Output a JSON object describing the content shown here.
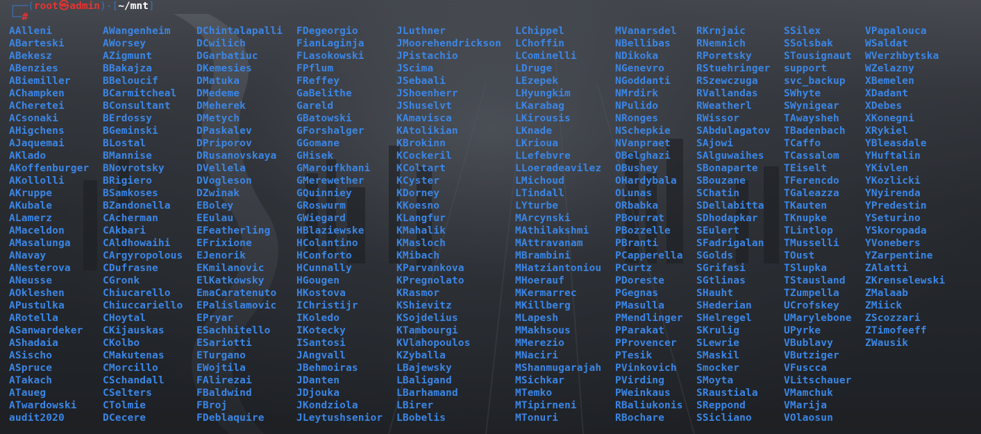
{
  "prompt": {
    "user": "root",
    "host": "admin",
    "cwd": "~/mnt",
    "symbol": "#"
  },
  "listing": {
    "columns": [
      [
        "AAlleni",
        "ABarteski",
        "ABekesz",
        "ABenzies",
        "ABiemiller",
        "AChampken",
        "ACheretei",
        "ACsonaki",
        "AHigchens",
        "AJaquemai",
        "AKlado",
        "AKoffenburger",
        "AKollolli",
        "AKruppe",
        "AKubale",
        "ALamerz",
        "AMaceldon",
        "AMasalunga",
        "ANavay",
        "ANesterova",
        "ANeusse",
        "AOkleshen",
        "APustulka",
        "ARotella",
        "ASanwardeker",
        "AShadaia",
        "ASischo",
        "ASpruce",
        "ATakach",
        "ATaueg",
        "ATwardowski",
        "audit2020"
      ],
      [
        "AWangenheim",
        "AWorsey",
        "AZigmunt",
        "BBakajza",
        "BBeloucif",
        "BCarmitcheal",
        "BConsultant",
        "BErdossy",
        "BGeminski",
        "BLostal",
        "BMannise",
        "BNovrotsky",
        "BRigiero",
        "BSamkoses",
        "BZandonella",
        "CAcherman",
        "CAkbari",
        "CAldhowaihi",
        "CArgyropolous",
        "CDufrasne",
        "CGronk",
        "Chiucarello",
        "Chiuccariello",
        "CHoytal",
        "CKijauskas",
        "CKolbo",
        "CMakutenas",
        "CMorcillo",
        "CSchandall",
        "CSelters",
        "CTolmie",
        "DCecere"
      ],
      [
        "DChintalapalli",
        "DCwilich",
        "DGarbatiuc",
        "DKemesies",
        "DMatuka",
        "DMedeme",
        "DMeherek",
        "DMetych",
        "DPaskalev",
        "DPriporov",
        "DRusanovskaya",
        "DVellela",
        "DVogleson",
        "DZwinak",
        "EBoley",
        "EEulau",
        "EFeatherling",
        "EFrixione",
        "EJenorik",
        "EKmilanovic",
        "ElKatkowsky",
        "EmaCaratenuto",
        "EPalislamovic",
        "EPryar",
        "ESachhitello",
        "ESariotti",
        "ETurgano",
        "EWojtila",
        "FAlirezai",
        "FBaldwind",
        "FBroj",
        "FDeblaquire"
      ],
      [
        "FDegeorgio",
        "FianLaginja",
        "FLasokowski",
        "FPflum",
        "FReffey",
        "GaBelithe",
        "Gareld",
        "GBatowski",
        "GForshalger",
        "GGomane",
        "GHisek",
        "GMaroufkhani",
        "GMerewether",
        "GQuinniey",
        "GRoswurm",
        "GWiegard",
        "HBlaziewske",
        "HColantino",
        "HConforto",
        "HCunnally",
        "HGougen",
        "HKostova",
        "IChristijr",
        "IKoledo",
        "IKotecky",
        "ISantosi",
        "JAngvall",
        "JBehmoiras",
        "JDanten",
        "JDjouka",
        "JKondziola",
        "JLeytushsenior"
      ],
      [
        "JLuthner",
        "JMoorehendrickson",
        "JPistachio",
        "JScima",
        "JSebaali",
        "JShoenherr",
        "JShuselvt",
        "KAmavisca",
        "KAtolikian",
        "KBrokinn",
        "KCockeril",
        "KColtart",
        "KCyster",
        "KDorney",
        "KKoesno",
        "KLangfur",
        "KMahalik",
        "KMasloch",
        "KMibach",
        "KParvankova",
        "KPregnolato",
        "KRasmor",
        "KShievitz",
        "KSojdelius",
        "KTambourgi",
        "KVlahopoulos",
        "KZyballa",
        "LBajewsky",
        "LBaligand",
        "LBarhamand",
        "LBirer",
        "LBobelis"
      ],
      [
        "LChippel",
        "LChoffin",
        "LCominelli",
        "LDruge",
        "LEzepek",
        "LHyungkim",
        "LKarabag",
        "LKirousis",
        "LKnade",
        "LKrioua",
        "LLefebvre",
        "LLoeradeavilez",
        "LMichoud",
        "LTindall",
        "LYturbe",
        "MArcynski",
        "MAthilakshmi",
        "MAttravanam",
        "MBrambini",
        "MHatziantoniou",
        "MHoerauf",
        "MKermarrec",
        "MKillberg",
        "MLapesh",
        "MMakhsous",
        "MMerezio",
        "MNaciri",
        "MShanmugarajah",
        "MSichkar",
        "MTemko",
        "MTipirneni",
        "MTonuri"
      ],
      [
        "MVanarsdel",
        "NBellibas",
        "NDikoka",
        "NGenevro",
        "NGoddanti",
        "NMrdirk",
        "NPulido",
        "NRonges",
        "NSchepkie",
        "NVanpraet",
        "OBelghazi",
        "OBushey",
        "OHardybala",
        "OLunas",
        "ORbabka",
        "PBourrat",
        "PBozzelle",
        "PBranti",
        "PCapperella",
        "PCurtz",
        "PDoreste",
        "PGegnas",
        "PMasulla",
        "PMendlinger",
        "PParakat",
        "PProvencer",
        "PTesik",
        "PVinkovich",
        "PVirding",
        "PWeinkaus",
        "RBaliukonis",
        "RBochare"
      ],
      [
        "RKrnjaic",
        "RNemnich",
        "RPoretsky",
        "RStuehringer",
        "RSzewczuga",
        "RVallandas",
        "RWeatherl",
        "RWissor",
        "SAbdulagatov",
        "SAjowi",
        "SAlguwaihes",
        "SBonaparte",
        "SBouzane",
        "SChatin",
        "SDellabitta",
        "SDhodapkar",
        "SEulert",
        "SFadrigalan",
        "SGolds",
        "SGrifasi",
        "SGtlinas",
        "SHauht",
        "SHederian",
        "SHelregel",
        "SKrulig",
        "SLewrie",
        "SMaskil",
        "Smocker",
        "SMoyta",
        "SRaustiala",
        "SReppond",
        "SSicliano"
      ],
      [
        "SSilex",
        "SSolsbak",
        "STousignaut",
        "support",
        "svc_backup",
        "SWhyte",
        "SWynigear",
        "TAwaysheh",
        "TBadenbach",
        "TCaffo",
        "TCassalom",
        "TEiselt",
        "TFerencdo",
        "TGaleazza",
        "TKauten",
        "TKnupke",
        "TLintlop",
        "TMusselli",
        "TOust",
        "TSlupka",
        "TStausland",
        "TZumpella",
        "UCrofskey",
        "UMarylebone",
        "UPyrke",
        "VBublavy",
        "VButziger",
        "VFuscca",
        "VLitschauer",
        "VMamchuk",
        "VMarija",
        "VOlaosun"
      ],
      [
        "VPapalouca",
        "WSaldat",
        "WVerzhbytska",
        "WZelazny",
        "XBemelen",
        "XDadant",
        "XDebes",
        "XKonegni",
        "XRykiel",
        "YBleasdale",
        "YHuftalin",
        "YKivlen",
        "YKozlicki",
        "YNyirenda",
        "YPredestin",
        "YSeturino",
        "YSkoropada",
        "YVonebers",
        "YZarpentine",
        "ZAlatti",
        "ZKrenselewski",
        "ZMalaab",
        "ZMiick",
        "ZScozzari",
        "ZTimofeeff",
        "ZWausik"
      ]
    ]
  }
}
